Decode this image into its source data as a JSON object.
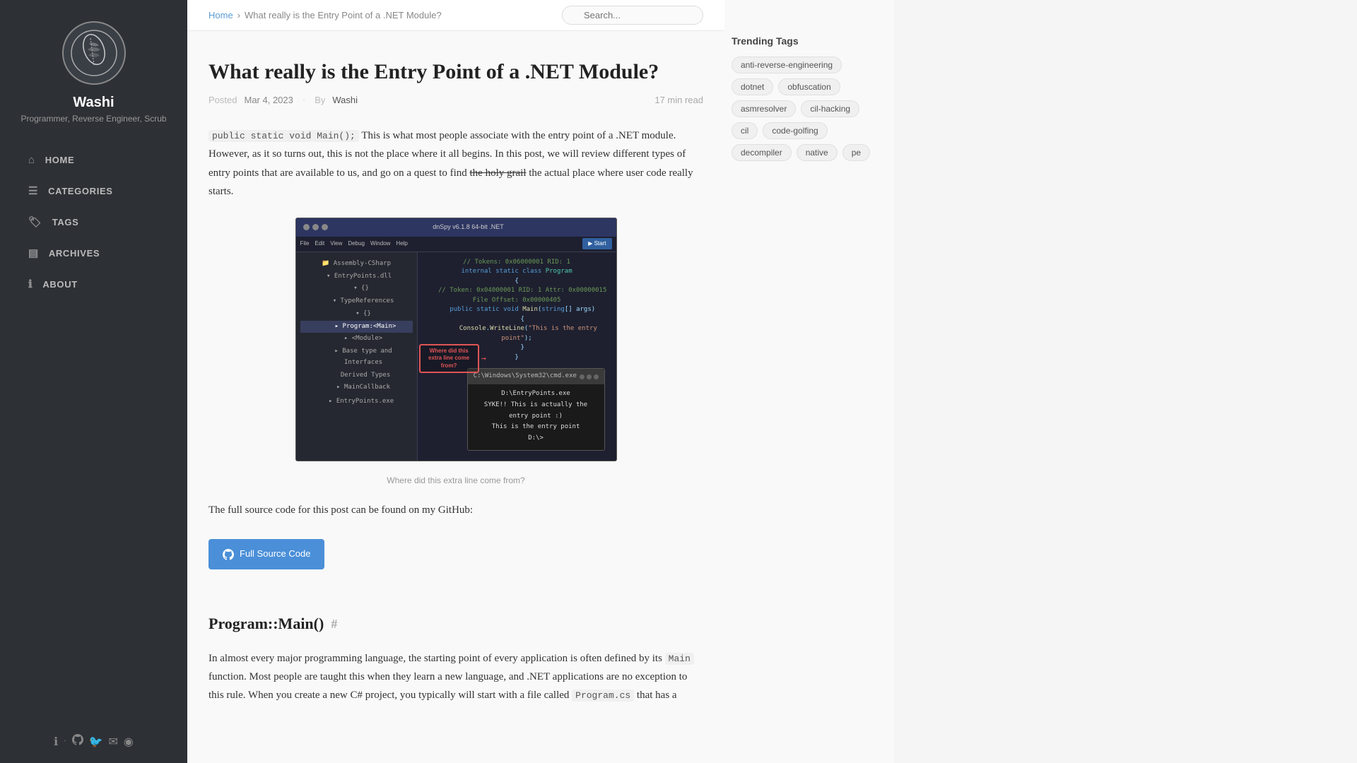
{
  "sidebar": {
    "avatar_alt": "Washi avatar feather",
    "name": "Washi",
    "subtitle": "Programmer, Reverse Engineer, Scrub",
    "nav": [
      {
        "id": "home",
        "label": "HOME",
        "icon": "⌂"
      },
      {
        "id": "categories",
        "label": "CATEGORIES",
        "icon": "☰"
      },
      {
        "id": "tags",
        "label": "TAGS",
        "icon": "🏷"
      },
      {
        "id": "archives",
        "label": "ARCHIVES",
        "icon": "▤"
      },
      {
        "id": "about",
        "label": "ABOUT",
        "icon": "ℹ"
      }
    ],
    "social": [
      {
        "id": "info",
        "icon": "ℹ",
        "href": "#"
      },
      {
        "id": "github",
        "icon": "⊙",
        "href": "#"
      },
      {
        "id": "twitter",
        "icon": "🐦",
        "href": "#"
      },
      {
        "id": "email",
        "icon": "✉",
        "href": "#"
      },
      {
        "id": "rss",
        "icon": "◉",
        "href": "#"
      }
    ]
  },
  "topbar": {
    "breadcrumb_home": "Home",
    "breadcrumb_sep": "›",
    "breadcrumb_current": "What really is the Entry Point of a .NET Module?",
    "search_placeholder": "Search..."
  },
  "article": {
    "title": "What really is the Entry Point of a .NET Module?",
    "meta_posted": "Posted",
    "meta_date": "Mar 4, 2023",
    "meta_by": "By",
    "meta_author": "Washi",
    "meta_read": "17 min read",
    "inline_code1": "public static void Main();",
    "body_intro": "This is what most people associate with the entry point of a .NET module. However, as it so turns out, this is not the place where it all begins. In this post, we will review different types of entry points that are available to us, and go on a quest to find",
    "strikethrough": "the holy grail",
    "body_intro2": "the actual place where user code really starts.",
    "image_caption": "Where did this extra line come from?",
    "annotation_text": "Where did this extra line come from?",
    "github_button_label": "Full Source Code",
    "source_text": "The full source code for this post can be found on my GitHub:",
    "section1_title": "Program::Main()",
    "section1_hash": "#",
    "section1_body1": "In almost every major programming language, the starting point of every application is often defined by its",
    "section1_inline1": "Main",
    "section1_body2": "function. Most people are taught this when they learn a new language, and .NET applications are no exception to this rule. When you create a new C# project, you typically will start with a file called",
    "section1_inline2": "Program.cs",
    "section1_body3": "that has a"
  },
  "right_sidebar": {
    "trending_title": "Trending Tags",
    "tags": [
      "anti-reverse-engineering",
      "dotnet",
      "obfuscation",
      "asmresolver",
      "cil-hacking",
      "cil",
      "code-golfing",
      "decompiler",
      "native",
      "pe"
    ]
  }
}
